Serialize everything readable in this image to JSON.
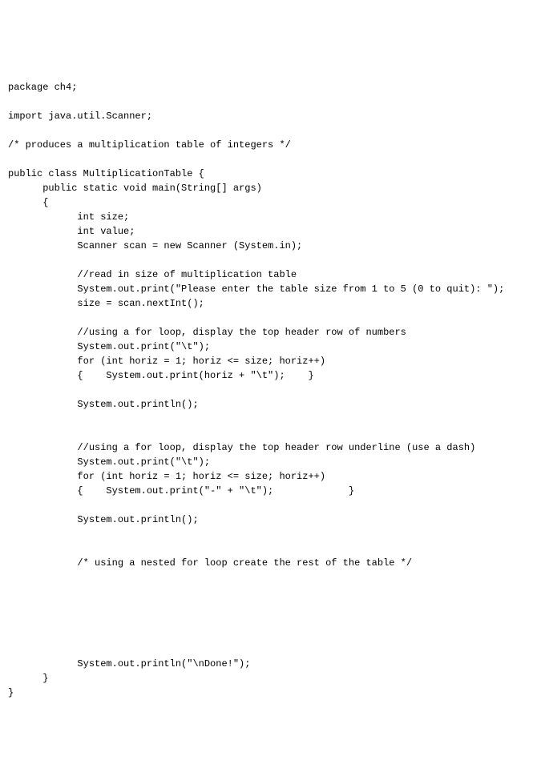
{
  "code": {
    "line1": "package ch4;",
    "line2": "",
    "line3": "import java.util.Scanner;",
    "line4": "",
    "line5": "/* produces a multiplication table of integers */",
    "line6": "",
    "line7": "public class MultiplicationTable {",
    "line8": "      public static void main(String[] args)",
    "line9": "      {",
    "line10": "            int size;",
    "line11": "            int value;",
    "line12": "            Scanner scan = new Scanner (System.in);",
    "line13": "",
    "line14": "            //read in size of multiplication table",
    "line15": "            System.out.print(\"Please enter the table size from 1 to 5 (0 to quit): \");",
    "line16": "            size = scan.nextInt();",
    "line17": "",
    "line18": "            //using a for loop, display the top header row of numbers",
    "line19": "            System.out.print(\"\\t\");",
    "line20": "            for (int horiz = 1; horiz <= size; horiz++)",
    "line21": "            {    System.out.print(horiz + \"\\t\");    }",
    "line22": "",
    "line23": "            System.out.println();",
    "line24": "",
    "line25": "",
    "line26": "            //using a for loop, display the top header row underline (use a dash)",
    "line27": "            System.out.print(\"\\t\");",
    "line28": "            for (int horiz = 1; horiz <= size; horiz++)",
    "line29": "            {    System.out.print(\"-\" + \"\\t\");             }",
    "line30": "",
    "line31": "            System.out.println();",
    "line32": "",
    "line33": "",
    "line34": "            /* using a nested for loop create the rest of the table */",
    "line35": "",
    "line36": "",
    "line37": "",
    "line38": "",
    "line39": "",
    "line40": "",
    "line41": "            System.out.println(\"\\nDone!\");",
    "line42": "      }",
    "line43": "}"
  }
}
